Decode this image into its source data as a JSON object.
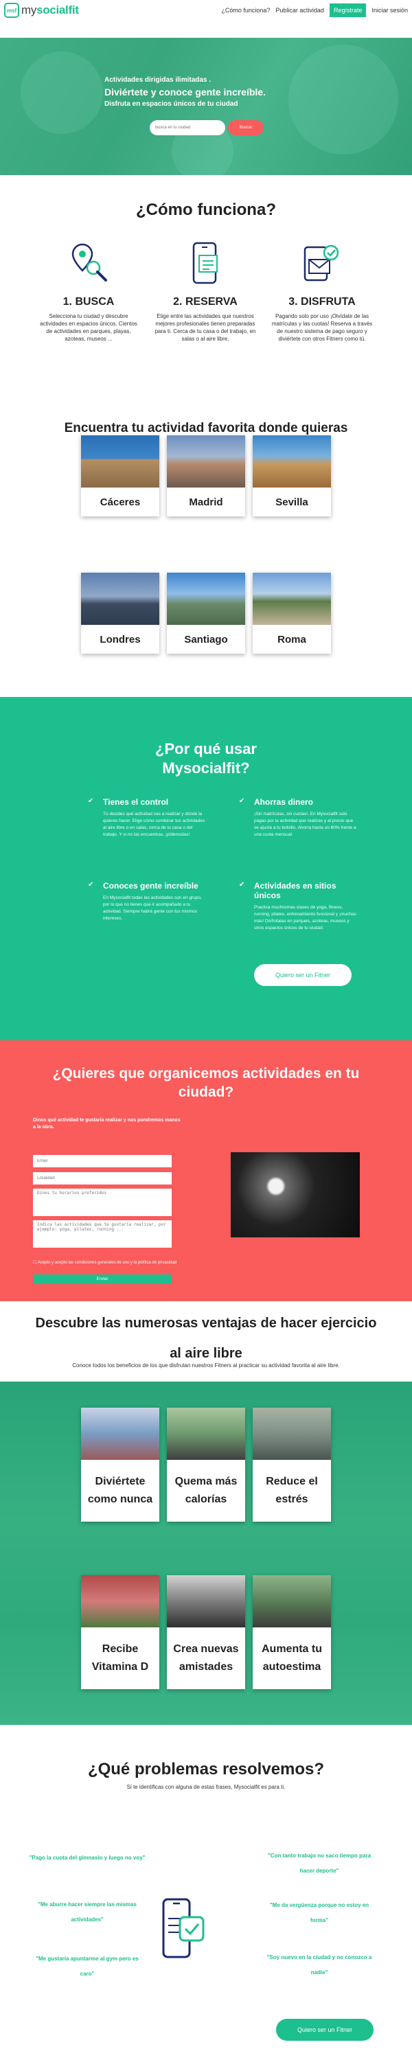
{
  "colors": {
    "accent": "#1dbf8f",
    "coral": "#fa5b5b",
    "text": "#222222"
  },
  "header": {
    "logo_mark": "msf",
    "logo_prefix": "my",
    "logo_brand": "socialfit",
    "nav": {
      "how": "¿Cómo funciona?",
      "publish": "Publicar actividad",
      "register": "Regístrate",
      "login": "Iniciar sesión"
    }
  },
  "hero": {
    "line1": "Actividades dirigidas ilimitadas .",
    "line2": "Diviértete y conoce gente increíble.",
    "line3": "Disfruta en espacios únicos de tu ciudad",
    "search_placeholder": "Busca en tu ciudad",
    "search_button": "Buscar"
  },
  "how": {
    "title": "¿Cómo funciona?",
    "steps": [
      {
        "icon": "location-search-icon",
        "title": "1. BUSCA",
        "desc": "Selecciona tu ciudad y descubre actividades en espacios únicos. Cientos de actividades en parques, playas, azoteas, museos ..."
      },
      {
        "icon": "phone-booking-icon",
        "title": "2. RESERVA",
        "desc": "Elige entre las actividades que nuestros mejores profesionales tienen preparadas para ti. Cerca de tu casa o del trabajo, en salas o al aire libre."
      },
      {
        "icon": "mail-check-icon",
        "title": "3. DISFRUTA",
        "desc": "Pagando solo por uso ¡Olvídate de las matrículas y las cuotas! Reserva a través de nuestro sistema de pago seguro y diviértete con otros Fitners como tú."
      }
    ]
  },
  "activities": {
    "title": "Encuentra tu actividad favorita donde quieras",
    "cities": [
      "Cáceres",
      "Madrid",
      "Sevilla",
      "Londres",
      "Santiago",
      "Roma"
    ]
  },
  "why": {
    "title_line1": "¿Por qué usar",
    "title_line2": "Mysocialfit?",
    "features": [
      {
        "title": "Tienes el control",
        "desc": "Tú decides qué actividad vas a realizar y dónde la quieres hacer. Elige cómo combinar tus actividades al aire libre o en salas, cerca de tu casa o del trabajo. Y si no las encuentras, ¡pídenoslas!"
      },
      {
        "title": "Ahorras dinero",
        "desc": "¡Sin matrículas, sin cuotas!. En Mysocialfit solo pagas por la actividad que realizas y al precio que se ajusta a tu bolsillo. Ahorra hasta un 60% frente a una cuota mensual."
      },
      {
        "title": "Conoces gente increíble",
        "desc": "En Mysocialfit todas las actividades son en grupo, por lo que no tienes que ir acompañado a tu actividad. Siempre habrá gente con tus mismos intereses."
      },
      {
        "title": "Actividades en sitios únicos",
        "desc": "Practica muchísimas clases de yoga, fitness, running, pilates, entrenamiento funcional y ¡muchas más! Disfrútalas en parques, azoteas, museos y otros espacios únicos de tu ciudad."
      }
    ],
    "button": "Quiero ser un Fitner"
  },
  "organize": {
    "title_line1": "¿Quieres que organicemos actividades en tu",
    "title_line2": "ciudad?",
    "subtitle": "Dinos qué actividad te gustaría realizar y nos pondremos manos a la obra.",
    "fields": {
      "email": "Email",
      "location": "Localidad",
      "activities": "Dinos tu horarios preferidos",
      "suggestion": "Indica las actividades que te gustaría realizar, por ejemplo: yoga, pilates, running ..."
    },
    "accept_note": "Acepto y acepto las condiciones generales de uso y la política de privacidad",
    "submit": "Enviar"
  },
  "benefits": {
    "title_line1": "Descubre las numerosas ventajas de hacer ejercicio",
    "title_line2": "al aire libre",
    "subtitle": "Conoce todos los beneficios de los que disfrutan nuestros Fitners al practicar su actividad favorita al aire libre.",
    "cards": [
      "Diviértete como nunca",
      "Quema más calorías",
      "Reduce el estrés",
      "Recibe Vitamina D",
      "Crea nuevas amistades",
      "Aumenta tu autoestima"
    ]
  },
  "problems": {
    "title": "¿Qué problemas resolvemos?",
    "subtitle": "Si te identificas con alguna de estas frases, Mysocialfit es para ti.",
    "quotes_left": [
      "\"Pago la cuota del gimnasio y luego no voy\"",
      "\"Me aburre hacer siempre las mismas actividades\"",
      "\"Me gustaría apuntarme al gym pero es caro\""
    ],
    "quotes_right": [
      "\"Con tanto trabajo no saco tiempo para hacer deporte\"",
      "\"Me da vergüenza porque no estoy en forma\"",
      "\"Soy nuevo en la ciudad y no conozco a nadie\""
    ],
    "button": "Quiero ser un Fitner"
  }
}
